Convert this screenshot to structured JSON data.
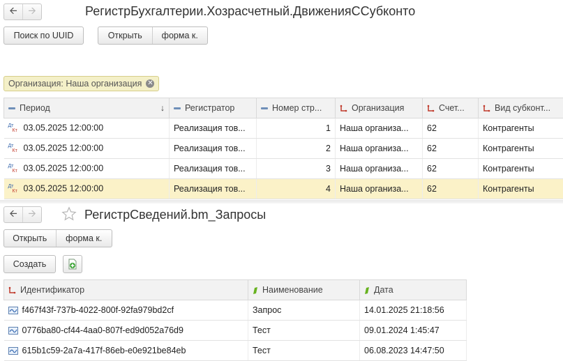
{
  "window1": {
    "title": "РегистрБухгалтерии.Хозрасчетный.ДвиженияССубконто",
    "search_uuid_label": "Поиск по UUID",
    "open_label": "Открыть",
    "form_label": "форма к.",
    "filter_label": "Организация: Наша организация",
    "columns": {
      "period": "Период",
      "registrar": "Регистратор",
      "line_number": "Номер стр...",
      "organization": "Организация",
      "account": "Счет...",
      "subconto_kind": "Вид субконт..."
    },
    "rows": [
      {
        "icon_top": "Дт",
        "icon_bottom": "Кт",
        "period": "03.05.2025 12:00:00",
        "registrar": "Реализация тов...",
        "line_number": "1",
        "organization": "Наша организа...",
        "account": "62",
        "subconto_kind": "Контрагенты"
      },
      {
        "icon_top": "Дт",
        "icon_bottom": "Кт",
        "period": "03.05.2025 12:00:00",
        "registrar": "Реализация тов...",
        "line_number": "2",
        "organization": "Наша организа...",
        "account": "62",
        "subconto_kind": "Контрагенты"
      },
      {
        "icon_top": "Дт",
        "icon_bottom": "Кт",
        "period": "03.05.2025 12:00:00",
        "registrar": "Реализация тов...",
        "line_number": "3",
        "organization": "Наша организа...",
        "account": "62",
        "subconto_kind": "Контрагенты"
      },
      {
        "icon_top": "Дт",
        "icon_bottom": "Кт",
        "period": "03.05.2025 12:00:00",
        "registrar": "Реализация тов...",
        "line_number": "4",
        "organization": "Наша организа...",
        "account": "62",
        "subconto_kind": "Контрагенты"
      }
    ],
    "selected_row_index": 3,
    "sort_indicator": "↓"
  },
  "window2": {
    "title": "РегистрСведений.bm_Запросы",
    "open_label": "Открыть",
    "form_label": "форма к.",
    "create_label": "Создать",
    "columns": {
      "identifier": "Идентификатор",
      "name": "Наименование",
      "date": "Дата"
    },
    "rows": [
      {
        "identifier": "f467f43f-737b-4022-800f-92fa979bd2cf",
        "name": "Запрос",
        "date": "14.01.2025 21:18:56"
      },
      {
        "identifier": "0776ba80-cf44-4aa0-807f-ed9d052a76d9",
        "name": "Тест",
        "date": "09.01.2024 1:45:47"
      },
      {
        "identifier": "615b1c59-2a7a-417f-86eb-e0e921be84eb",
        "name": "Тест",
        "date": "06.08.2023 14:47:50"
      }
    ]
  },
  "colors": {
    "selected_row": "#fbf2c8",
    "filter_bg": "#f4f0c8",
    "header_bg": "#f2f2f2"
  },
  "icons": {
    "back": "arrow-left-icon",
    "forward": "arrow-right-icon",
    "favorite": "star-icon",
    "add_copy": "add-document-icon",
    "record": "register-record-icon"
  }
}
